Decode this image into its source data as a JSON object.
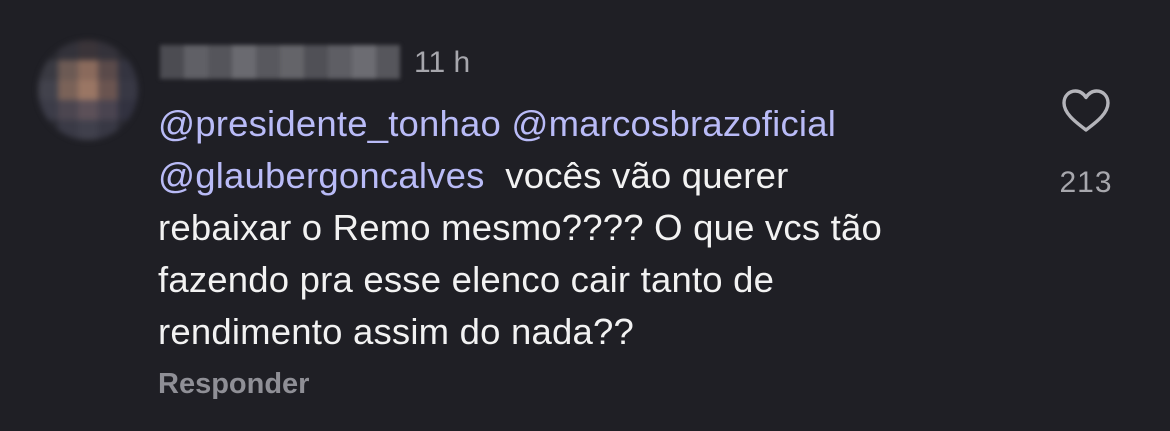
{
  "comment": {
    "time": "11 h",
    "mentions": [
      "@presidente_tonhao",
      "@marcosbrazoficial",
      "@glaubergoncalves"
    ],
    "text_parts": {
      "line2_rest": "vocês vão querer",
      "line3": "rebaixar o Remo mesmo???? O que vcs tão",
      "line4": "fazendo pra esse elenco cair tanto de",
      "line5": "rendimento assim do nada??"
    },
    "reply_label": "Responder",
    "like_count": "213"
  },
  "icons": {
    "like": "heart-outline-icon"
  },
  "colors": {
    "background": "#1f1f25",
    "mention": "#b9bbf7",
    "text": "#f2f2f2",
    "muted": "#a7a7ad"
  }
}
